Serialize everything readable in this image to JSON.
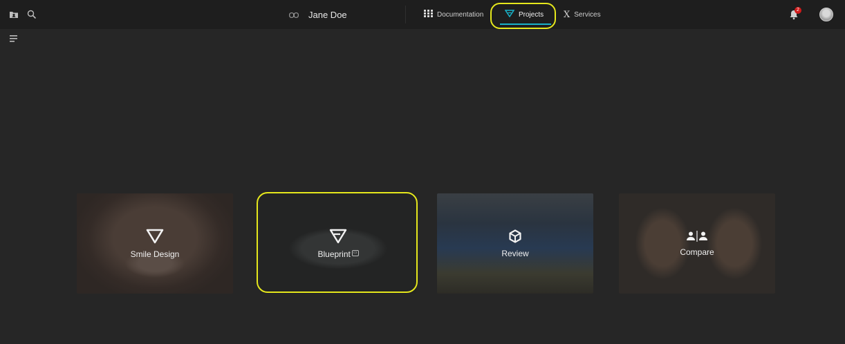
{
  "header": {
    "patient_name": "Jane Doe",
    "nav": [
      {
        "label": "Documentation",
        "icon": "grid-icon"
      },
      {
        "label": "Projects",
        "icon": "projects-logo-icon",
        "active": true
      },
      {
        "label": "Services",
        "icon": "sigma-icon"
      }
    ],
    "notifications_count": "2"
  },
  "colors": {
    "accent": "#19b3c9",
    "highlight": "#e6e81c",
    "badge": "#d21b1b"
  },
  "cards": [
    {
      "label": "Smile Design",
      "icon": "triangle-down-icon"
    },
    {
      "label": "Blueprint",
      "icon": "blueprint-logo-icon",
      "tag": "beta-icon"
    },
    {
      "label": "Review",
      "icon": "cube-icon"
    },
    {
      "label": "Compare",
      "icon": "compare-persons-icon"
    }
  ]
}
